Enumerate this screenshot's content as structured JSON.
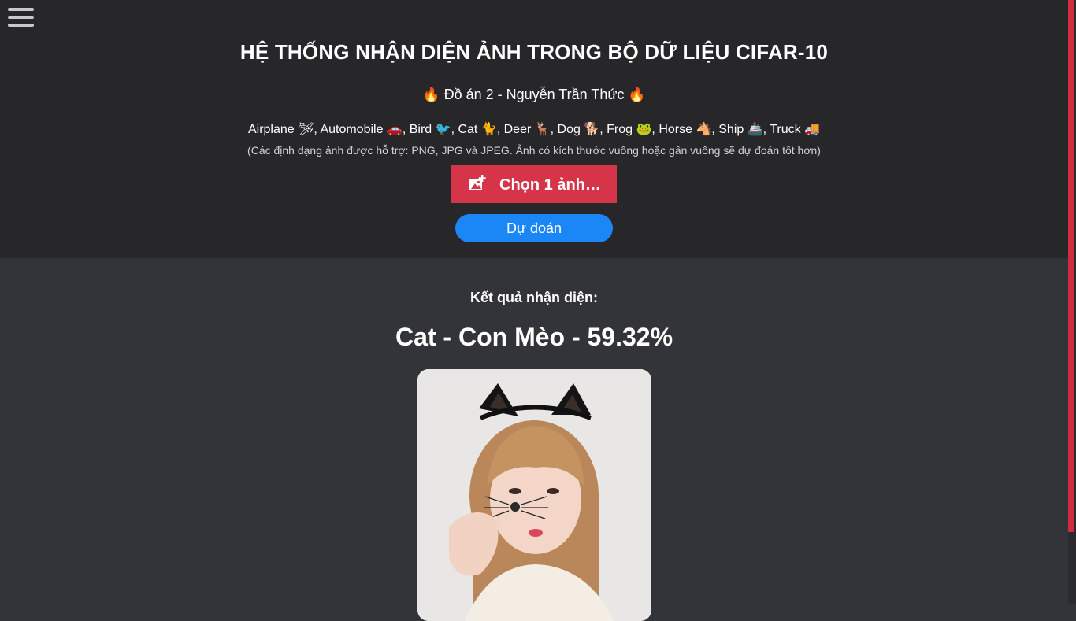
{
  "menu": {
    "icon": "hamburger-menu-icon"
  },
  "header": {
    "title": "HỆ THỐNG NHẬN DIỆN ẢNH TRONG BỘ DỮ LIỆU CIFAR-10",
    "subtitle": "🔥 Đồ án 2 - Nguyễn Trần Thức 🔥",
    "classes": "Airplane 🛩, Automobile 🚗, Bird 🐦, Cat 🐈, Deer 🦌, Dog 🐕, Frog 🐸, Horse 🐴, Ship 🚢, Truck 🚚",
    "note": "(Các định dạng ảnh được hỗ trợ: PNG, JPG và JPEG. Ảnh có kích thước vuông hoặc gần vuông sẽ dự đoán tốt hơn)"
  },
  "upload": {
    "label": "Chọn 1 ảnh…",
    "icon": "add-photo-icon"
  },
  "predict": {
    "label": "Dự đoán"
  },
  "result": {
    "label": "Kết quả nhận diện:",
    "value": "Cat - Con Mèo - 59.32%"
  },
  "colors": {
    "header_bg": "#27272a",
    "body_bg": "#333439",
    "upload_button": "#d63449",
    "predict_button": "#1b87f7",
    "scrollbar_thumb": "#cf2d3d"
  }
}
